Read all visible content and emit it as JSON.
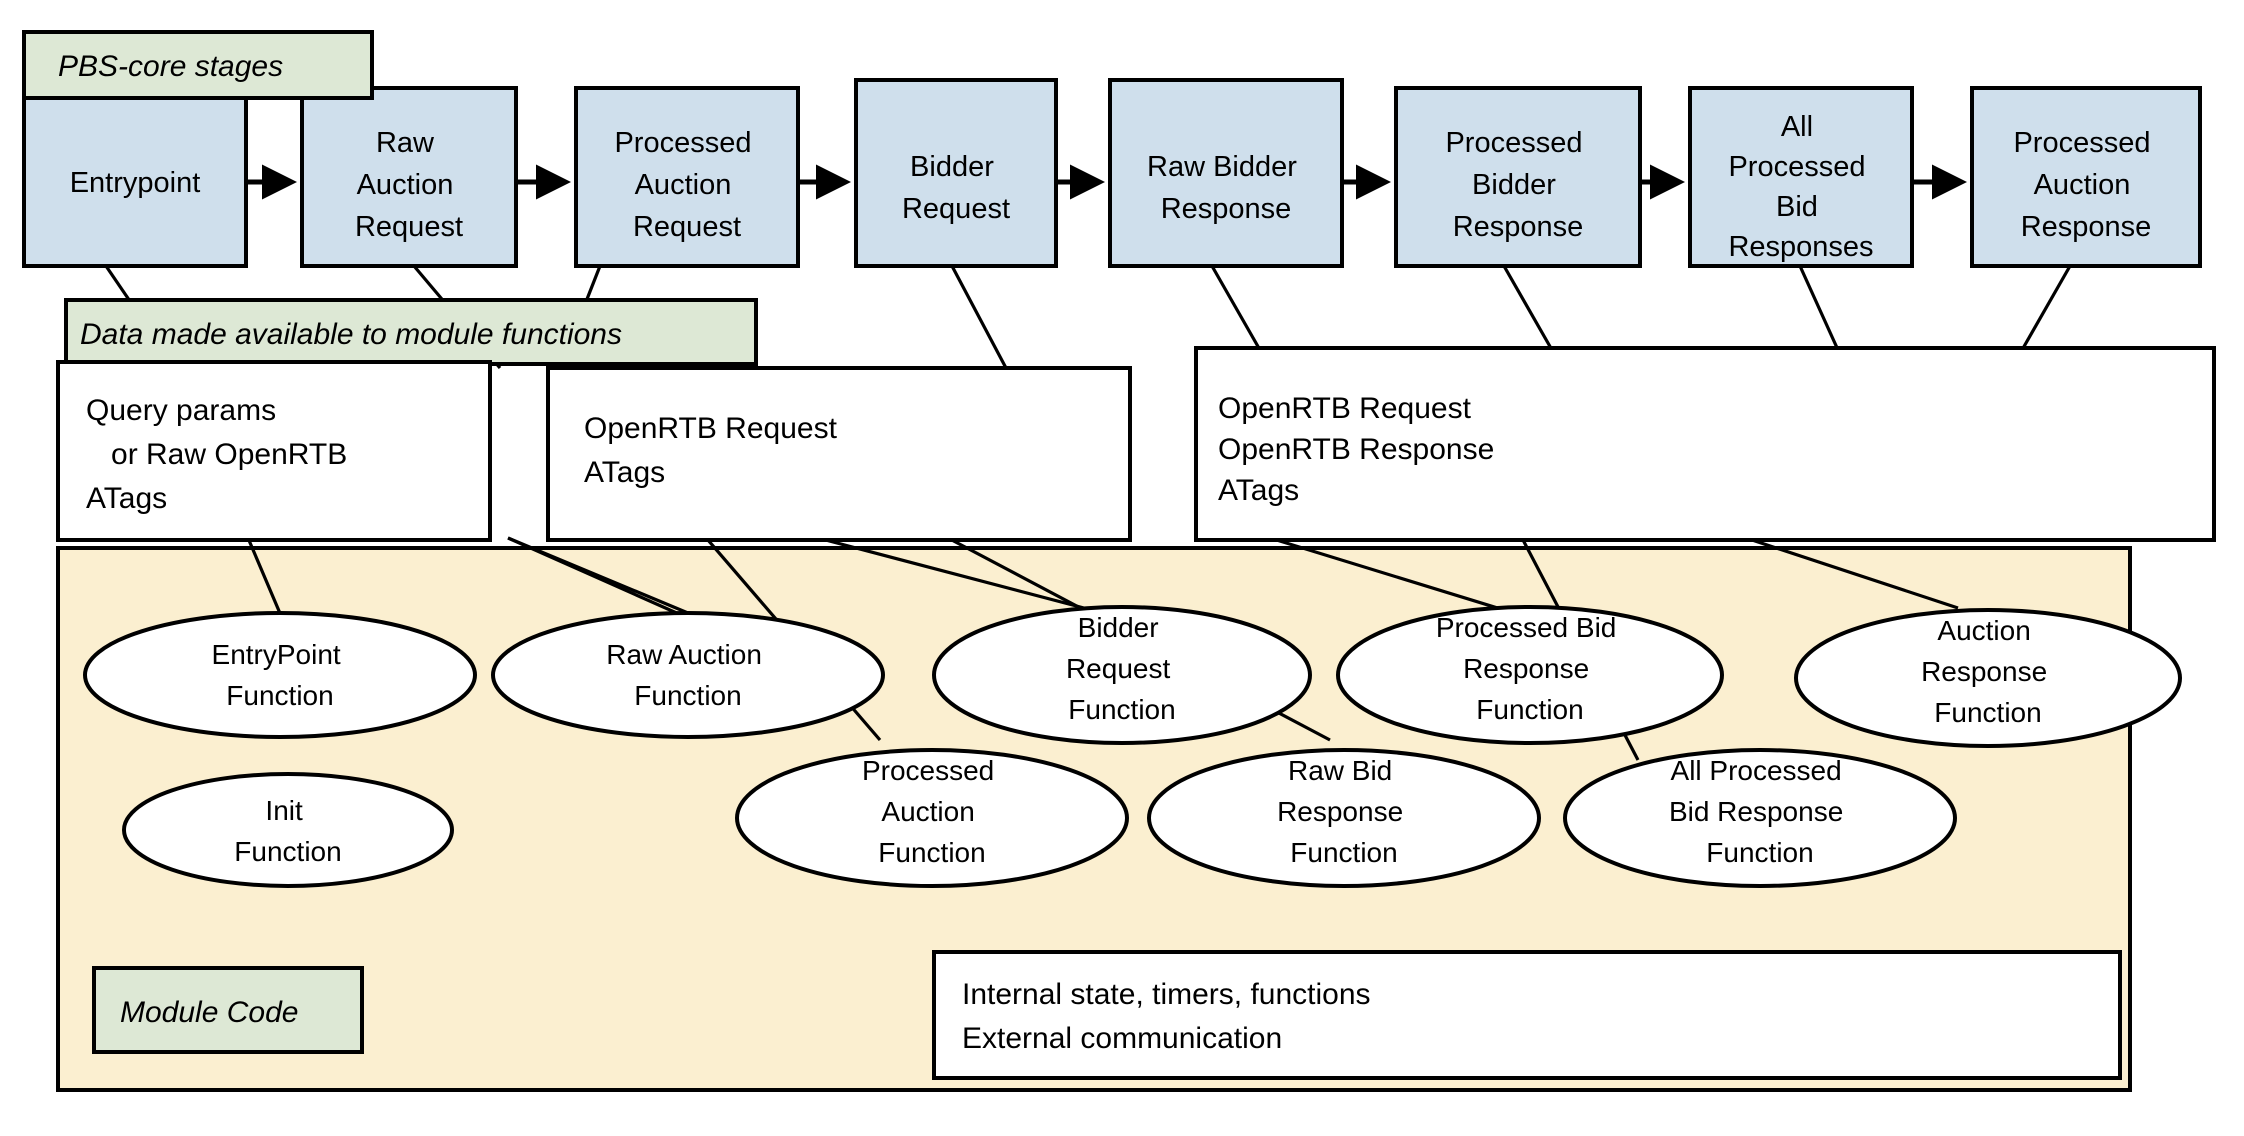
{
  "legends": {
    "pbs_core_stages": "PBS-core stages",
    "data_available": "Data made available to module functions",
    "module_code": "Module Code"
  },
  "colors": {
    "stage_fill": "#cfdfec",
    "legend_fill": "#dde8d5",
    "module_region_fill": "#fbefd0",
    "data_box_fill": "#ffffff",
    "ellipse_fill": "#ffffff",
    "stroke": "#000000"
  },
  "stages": [
    {
      "id": "entrypoint",
      "lines": [
        "Entrypoint"
      ]
    },
    {
      "id": "raw-auction-request",
      "lines": [
        "Raw",
        "Auction",
        "Request"
      ]
    },
    {
      "id": "processed-auction-request",
      "lines": [
        "Processed",
        "Auction",
        "Request"
      ]
    },
    {
      "id": "bidder-request",
      "lines": [
        "Bidder",
        "Request"
      ]
    },
    {
      "id": "raw-bidder-response",
      "lines": [
        "Raw Bidder",
        "Response"
      ]
    },
    {
      "id": "processed-bidder-response",
      "lines": [
        "Processed",
        "Bidder",
        "Response"
      ]
    },
    {
      "id": "all-processed-bid-responses",
      "lines": [
        "All",
        "Processed",
        "Bid",
        "Responses"
      ]
    },
    {
      "id": "processed-auction-response",
      "lines": [
        "Processed",
        "Auction",
        "Response"
      ]
    }
  ],
  "data_boxes": [
    {
      "id": "entrypoint-data",
      "lines": [
        "Query params",
        "   or Raw OpenRTB",
        "ATags"
      ]
    },
    {
      "id": "auction-request-data",
      "lines": [
        "OpenRTB Request",
        "ATags"
      ]
    },
    {
      "id": "bid-response-data",
      "lines": [
        "OpenRTB Request",
        "OpenRTB Response",
        "ATags"
      ]
    }
  ],
  "functions": [
    {
      "id": "entrypoint-function",
      "lines": [
        "EntryPoint",
        "Function"
      ]
    },
    {
      "id": "raw-auction-function",
      "lines": [
        "Raw Auction",
        "Function"
      ]
    },
    {
      "id": "bidder-request-function",
      "lines": [
        "Bidder",
        "Request",
        "Function"
      ]
    },
    {
      "id": "processed-bid-response-function",
      "lines": [
        "Processed Bid",
        "Response",
        "Function"
      ]
    },
    {
      "id": "auction-response-function",
      "lines": [
        "Auction",
        "Response",
        "Function"
      ]
    },
    {
      "id": "init-function",
      "lines": [
        "Init",
        "Function"
      ]
    },
    {
      "id": "processed-auction-function",
      "lines": [
        "Processed",
        "Auction",
        "Function"
      ]
    },
    {
      "id": "raw-bid-response-function",
      "lines": [
        "Raw Bid",
        "Response",
        "Function"
      ]
    },
    {
      "id": "all-processed-bid-response-function",
      "lines": [
        "All Processed",
        "Bid Response",
        "Function"
      ]
    }
  ],
  "module_internals": {
    "id": "module-internals-box",
    "lines": [
      "Internal state, timers, functions",
      "External communication"
    ]
  }
}
